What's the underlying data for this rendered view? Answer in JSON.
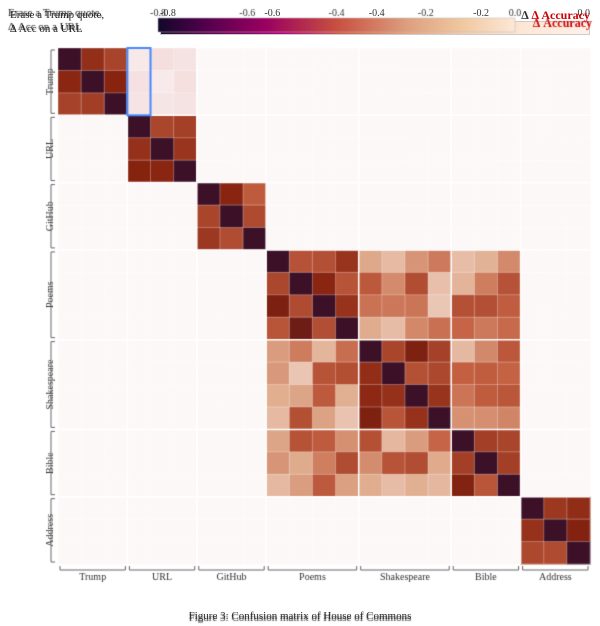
{
  "title": "Erase a Trump quote, ∆ Acc on a URL",
  "colorbar": {
    "ticks": [
      "-0.8",
      "-0.6",
      "-0.4",
      "-0.2",
      "0.0"
    ],
    "label": "∆ Accuracy"
  },
  "axes": {
    "row_groups": [
      {
        "label": "Trump",
        "rows": 3
      },
      {
        "label": "URL",
        "rows": 3
      },
      {
        "label": "GitHub",
        "rows": 3
      },
      {
        "label": "Poems",
        "rows": 4
      },
      {
        "label": "Shakespeare",
        "rows": 4
      },
      {
        "label": "Bible",
        "rows": 3
      },
      {
        "label": "Address",
        "rows": 3
      }
    ],
    "col_groups": [
      {
        "label": "Trump",
        "cols": 3
      },
      {
        "label": "URL",
        "cols": 3
      },
      {
        "label": "GitHub",
        "cols": 3
      },
      {
        "label": "Poems",
        "cols": 4
      },
      {
        "label": "Shakespeare",
        "cols": 4
      },
      {
        "label": "Bible",
        "cols": 3
      },
      {
        "label": "Address",
        "cols": 3
      }
    ]
  },
  "caption": "Figure 3: Confusion matrix of House of Commons"
}
